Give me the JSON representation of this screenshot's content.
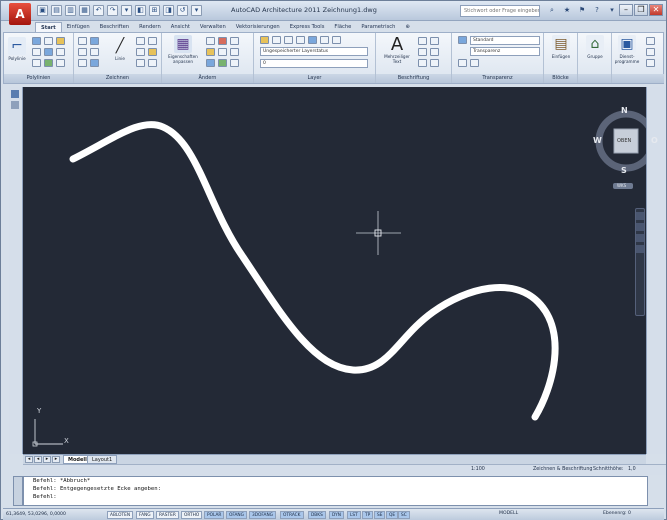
{
  "window": {
    "title": "AutoCAD Architecture 2011  Zeichnung1.dwg",
    "help_search_placeholder": "Stichwort oder Frage eingeben",
    "controls": [
      "–",
      "❐",
      "✕"
    ]
  },
  "app_button": "A",
  "quick_access": [
    "▣",
    "▤",
    "▥",
    "▦",
    "↶",
    "↷",
    "▾",
    "◧",
    "⊞",
    "◨",
    "↺",
    "▾"
  ],
  "help_icons": [
    "⌕",
    "★",
    "⚑",
    "?",
    "▾"
  ],
  "tabs": [
    "Start",
    "Einfügen",
    "Beschriften",
    "Rendern",
    "Ansicht",
    "Verwalten",
    "Vektorisierungen",
    "Express Tools",
    "Fläche",
    "Parametrisch",
    "⊕"
  ],
  "ribbon": {
    "panels": {
      "pobjekte": "Polylinien",
      "zeichnen": "Zeichnen",
      "aendern": "Ändern",
      "layer": "Layer",
      "beschriftung": "Beschriftung",
      "textgruppe": "Transparenz",
      "bloecke": "Blöcke",
      "eigenschaften": "",
      "dienst": ""
    },
    "big_tools": {
      "polyline": "Polylinie",
      "linie": "Linie",
      "eigenschaften": "Eigenschaften anpassen",
      "text": "Mehrzeiliger Text",
      "einfuegen": "Einfügen",
      "gruppe": "Gruppe",
      "dienst": "Dienst-programme"
    },
    "combos": {
      "layer_state": "Ungespeicherter Layerstatus",
      "layer_current": "0",
      "text_style": "Standard",
      "transparency": "Transparenz"
    }
  },
  "canvas": {
    "background": "#232936",
    "curve_color": "#ffffff",
    "viewcube": {
      "face": "OBEN",
      "north": "N",
      "south": "S",
      "east": "O",
      "west": "W",
      "wcs": "WKS"
    },
    "ucs": {
      "x": "X",
      "y": "Y"
    }
  },
  "layout_tabs": [
    {
      "label": "Modell",
      "active": true
    },
    {
      "label": "Layout1",
      "active": false
    }
  ],
  "layout_nav": [
    "◂",
    "◂",
    "▸",
    "▸"
  ],
  "annotation": {
    "scale_label": "1:100",
    "scale_value": "1:100",
    "workspace": "Zeichnen & Beschriftung",
    "cut_label": "Schnitthöhe:",
    "cut_value": "1,0"
  },
  "command": {
    "lines": [
      "Befehl: *Abbruch*",
      "Befehl: Entgegengesetzte Ecke angeben:",
      "Befehl:"
    ]
  },
  "statusbar": {
    "coords": "61,3649, 53,0296, 0,0000",
    "toggles": [
      {
        "label": "ABLOTEN",
        "on": false
      },
      {
        "label": "FANG",
        "on": false
      },
      {
        "label": "RASTER",
        "on": false
      },
      {
        "label": "ORTHO",
        "on": false
      },
      {
        "label": "POLAR",
        "on": true
      },
      {
        "label": "OFANG",
        "on": true
      },
      {
        "label": "3DOFANG",
        "on": true
      },
      {
        "label": "OTRACK",
        "on": true
      },
      {
        "label": "DBKS",
        "on": true
      },
      {
        "label": "DYN",
        "on": true
      },
      {
        "label": "LST",
        "on": true
      },
      {
        "label": "TP",
        "on": true
      },
      {
        "label": "SE",
        "on": true
      },
      {
        "label": "QE",
        "on": true
      },
      {
        "label": "SC",
        "on": true
      }
    ],
    "model": "MODELL",
    "drawing_label": "Ebenenrg: 0"
  }
}
